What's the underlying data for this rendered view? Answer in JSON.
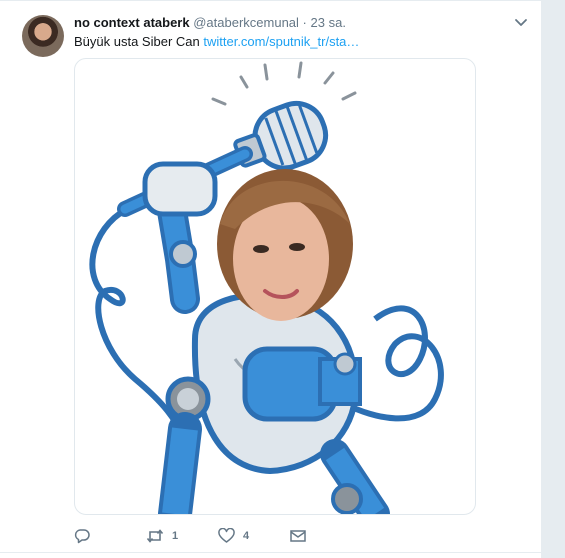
{
  "tweet": {
    "display_name": "no context ataberk",
    "handle": "@ataberkcemunal",
    "separator": "·",
    "time": "23 sa.",
    "text_plain": "Büyük usta Siber Can ",
    "text_link": "twitter.com/sputnik_tr/sta…"
  },
  "actions": {
    "reply_count": "",
    "retweet_count": "1",
    "like_count": "4"
  },
  "icons": {
    "reply": "reply-icon",
    "retweet": "retweet-icon",
    "like": "heart-icon",
    "dm": "envelope-icon",
    "menu": "chevron-down-icon"
  },
  "colors": {
    "link": "#1da1f2",
    "muted": "#657786",
    "robot_blue": "#3a8fd8"
  }
}
